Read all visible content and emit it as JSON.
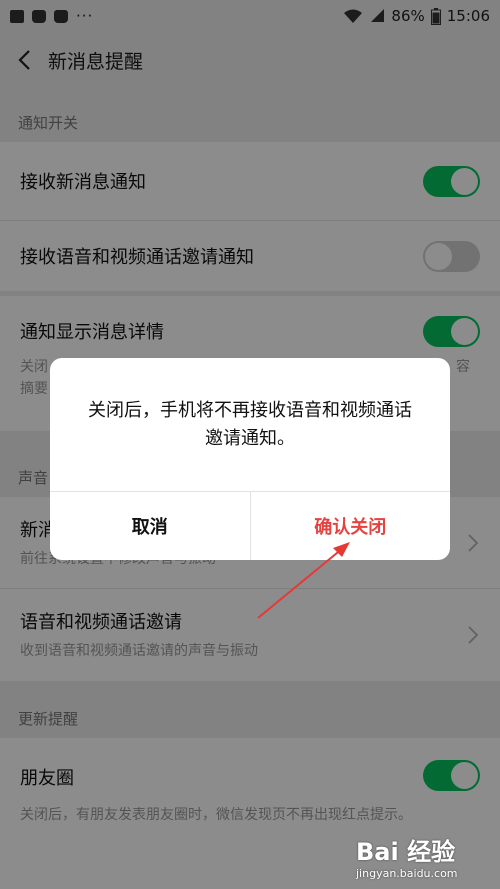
{
  "status_bar": {
    "dots": "···",
    "battery": "86%",
    "time": "15:06"
  },
  "nav": {
    "title": "新消息提醒"
  },
  "sections": {
    "notify_switch": "通知开关",
    "sound_partial": "声音",
    "update_reminder": "更新提醒"
  },
  "rows": {
    "receive_new_msg": {
      "title": "接收新消息通知",
      "toggle": "on"
    },
    "receive_voice_video": {
      "title": "接收语音和视频通话邀请通知",
      "toggle": "off"
    },
    "show_detail": {
      "title": "通知显示消息详情",
      "desc_left": "关闭",
      "desc_left2": "摘要",
      "desc_right": "容",
      "toggle": "on"
    },
    "new_msg_sound": {
      "title_partial": "新消",
      "desc": "前往系统设置中修改声音与振动"
    },
    "voice_video_invite": {
      "title": "语音和视频通话邀请",
      "desc": "收到语音和视频通话邀请的声音与振动"
    },
    "moments": {
      "title": "朋友圈",
      "desc": "关闭后，有朋友发表朋友圈时，微信发现页不再出现红点提示。",
      "toggle": "on"
    }
  },
  "dialog": {
    "message": "关闭后，手机将不再接收语音和视频通话邀请通知。",
    "cancel_label": "取消",
    "confirm_label": "确认关闭"
  },
  "watermark": {
    "logo": "Bai 经验",
    "url": "jingyan.baidu.com"
  },
  "colors": {
    "toggle_on": "#07c160",
    "toggle_off": "#cfcfcf",
    "confirm": "#e64340",
    "arrow": "#e53935"
  }
}
